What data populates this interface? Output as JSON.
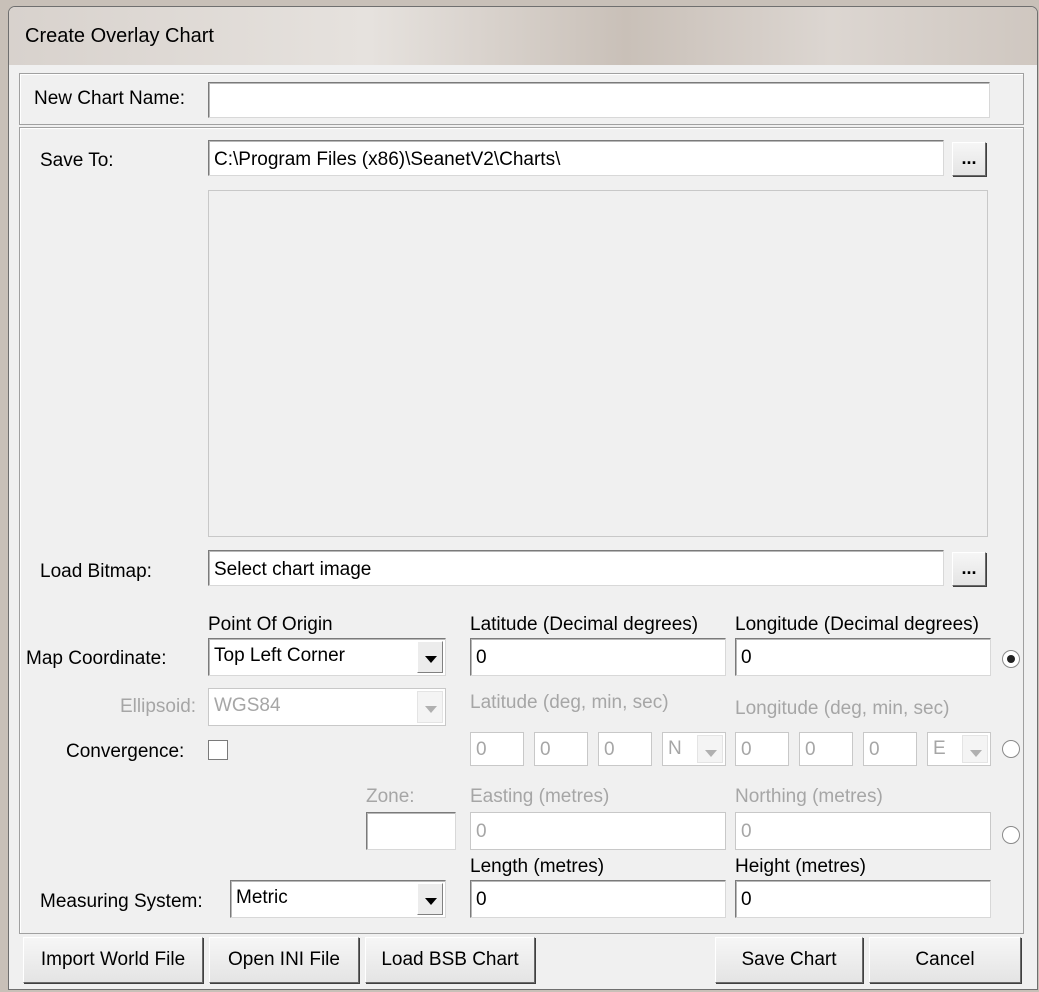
{
  "window": {
    "title": "Create Overlay Chart"
  },
  "chart_name": {
    "label": "New Chart Name:",
    "value": ""
  },
  "save_to": {
    "label": "Save To:",
    "value": "C:\\Program Files (x86)\\SeanetV2\\Charts\\",
    "browse_label": "..."
  },
  "load_bitmap": {
    "label": "Load Bitmap:",
    "value": "Select chart image",
    "browse_label": "..."
  },
  "map_coordinate": {
    "label": "Map Coordinate:",
    "origin_header": "Point Of Origin",
    "origin_value": "Top Left Corner",
    "lat_dec_header": "Latitude (Decimal degrees)",
    "lon_dec_header": "Longitude (Decimal degrees)",
    "lat_dec_value": "0",
    "lon_dec_value": "0"
  },
  "ellipsoid": {
    "label": "Ellipsoid:",
    "value": "WGS84"
  },
  "convergence": {
    "label": "Convergence:",
    "checked": false
  },
  "dms": {
    "lat_header": "Latitude (deg, min, sec)",
    "lon_header": "Longitude (deg, min, sec)",
    "lat_deg": "0",
    "lat_min": "0",
    "lat_sec": "0",
    "lat_hem": "N",
    "lon_deg": "0",
    "lon_min": "0",
    "lon_sec": "0",
    "lon_hem": "E"
  },
  "utm": {
    "zone_label": "Zone:",
    "zone_value": "",
    "easting_header": "Easting (metres)",
    "northing_header": "Northing (metres)",
    "easting_value": "0",
    "northing_value": "0"
  },
  "measuring": {
    "label": "Measuring System:",
    "value": "Metric",
    "length_header": "Length (metres)",
    "height_header": "Height (metres)",
    "length_value": "0",
    "height_value": "0"
  },
  "buttons": {
    "import_world": "Import World File",
    "open_ini": "Open INI File",
    "load_bsb": "Load BSB Chart",
    "save_chart": "Save Chart",
    "cancel": "Cancel"
  },
  "coordinate_mode": "decimal"
}
